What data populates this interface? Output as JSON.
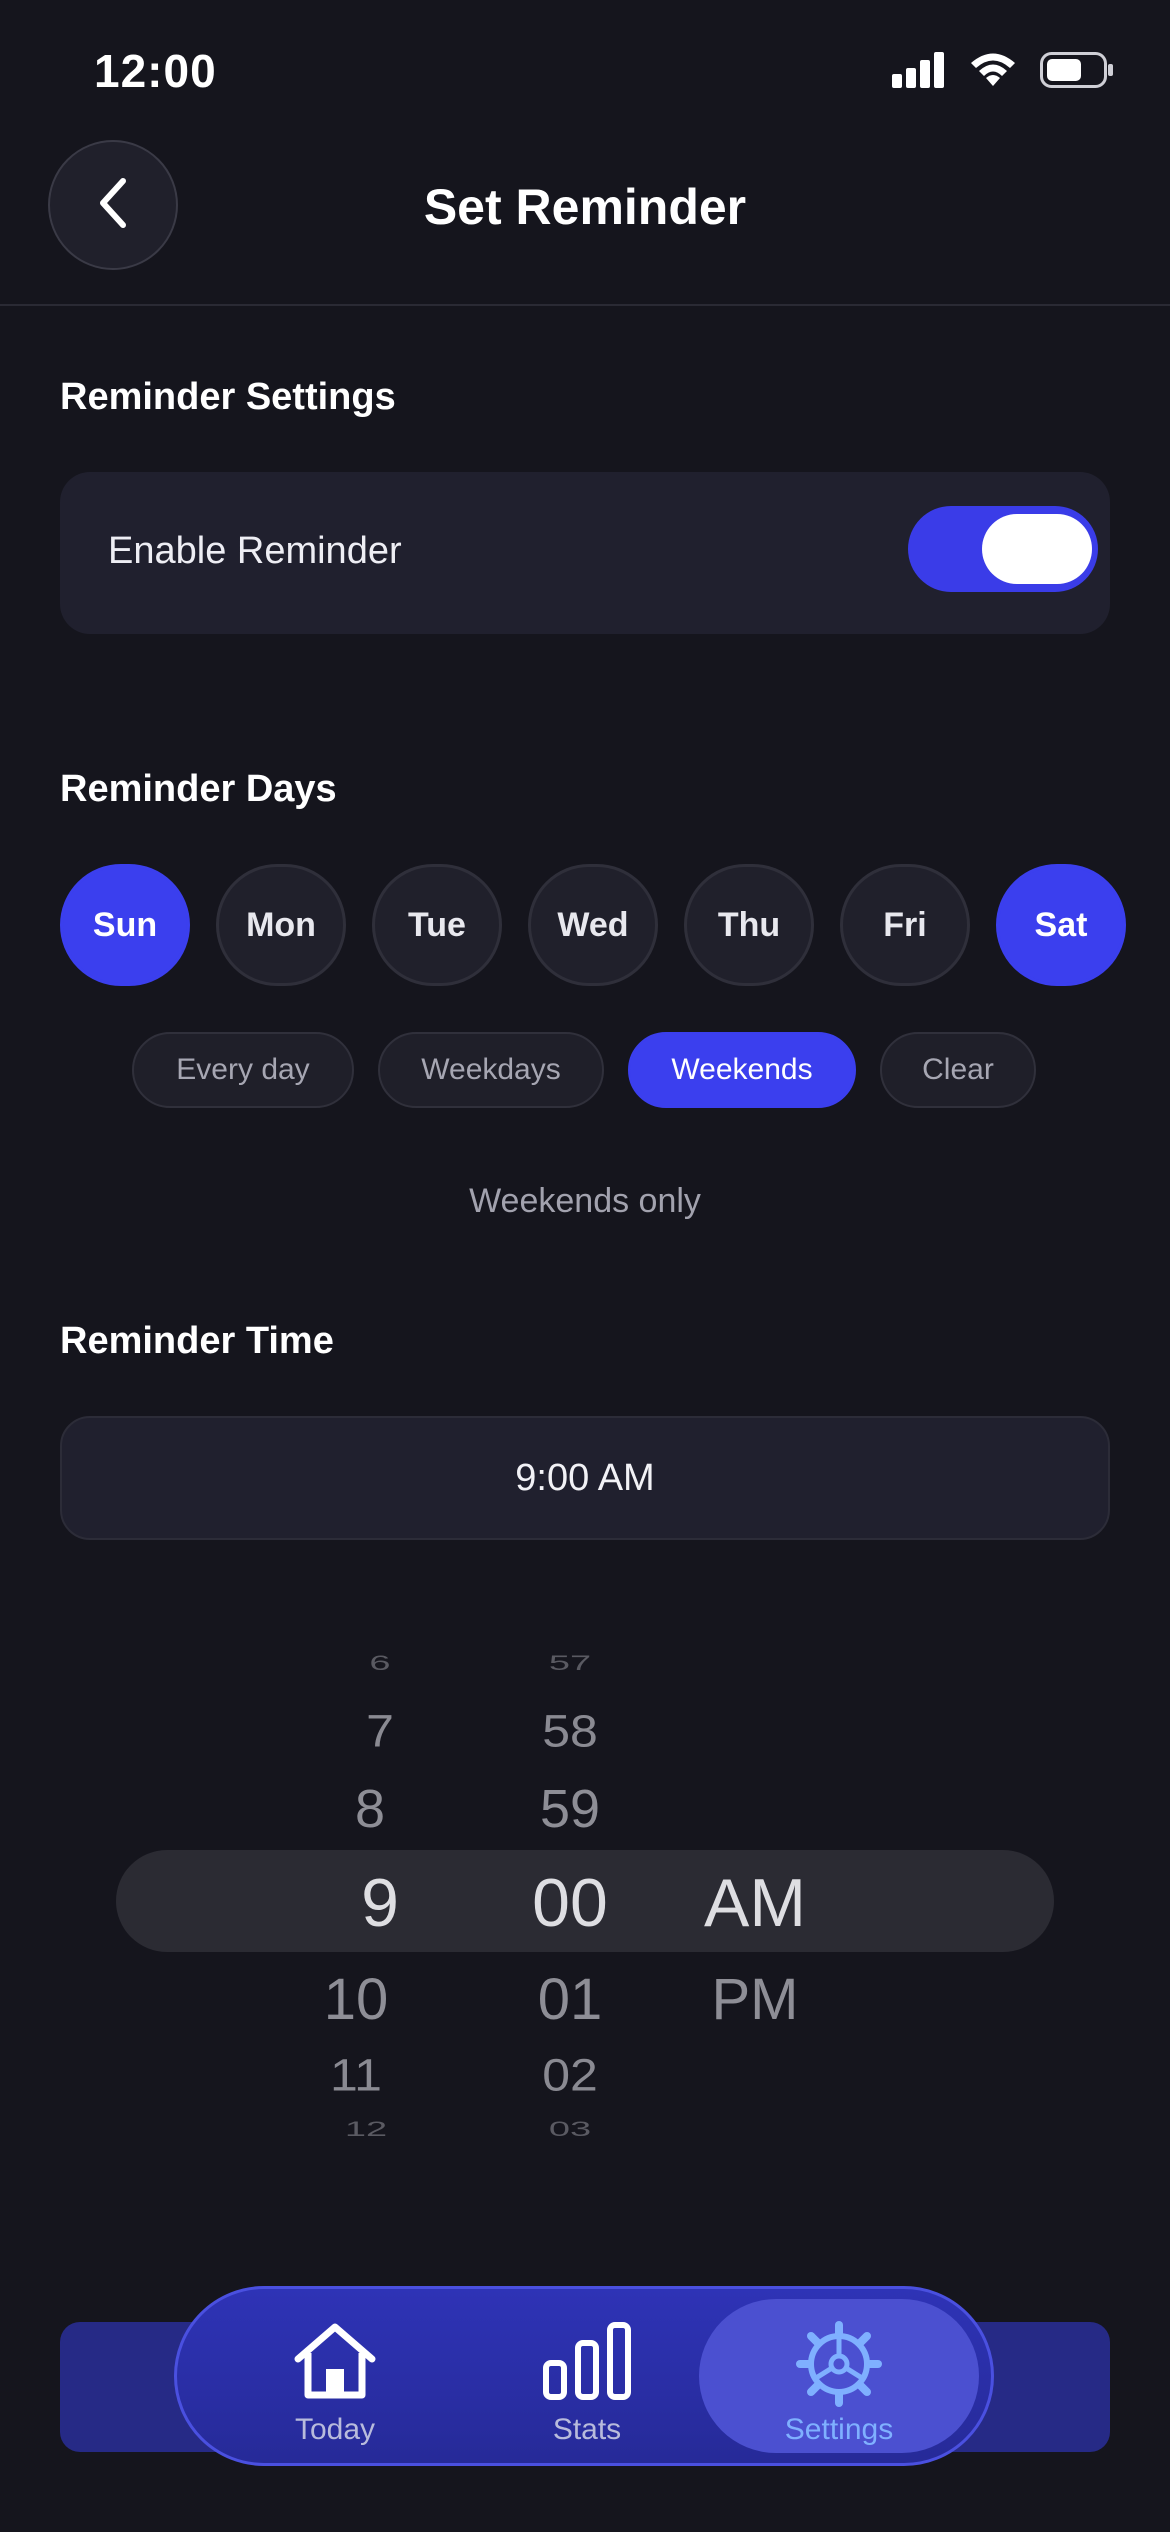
{
  "status_bar": {
    "time": "12:00"
  },
  "header": {
    "title": "Set Reminder"
  },
  "reminder_settings": {
    "section_title": "Reminder Settings",
    "enable_label": "Enable Reminder",
    "enabled": true
  },
  "reminder_days": {
    "section_title": "Reminder Days",
    "days": [
      {
        "label": "Sun",
        "selected": true
      },
      {
        "label": "Mon",
        "selected": false
      },
      {
        "label": "Tue",
        "selected": false
      },
      {
        "label": "Wed",
        "selected": false
      },
      {
        "label": "Thu",
        "selected": false
      },
      {
        "label": "Fri",
        "selected": false
      },
      {
        "label": "Sat",
        "selected": true
      }
    ],
    "presets": [
      {
        "label": "Every day",
        "selected": false
      },
      {
        "label": "Weekdays",
        "selected": false
      },
      {
        "label": "Weekends",
        "selected": true
      },
      {
        "label": "Clear",
        "selected": false
      }
    ],
    "summary": "Weekends only"
  },
  "reminder_time": {
    "section_title": "Reminder Time",
    "display": "9:00 AM",
    "picker": {
      "hours": [
        "6",
        "7",
        "8",
        "9",
        "10",
        "11",
        "12"
      ],
      "minutes": [
        "57",
        "58",
        "59",
        "00",
        "01",
        "02",
        "03"
      ],
      "periods": [
        "AM",
        "PM"
      ],
      "selected": {
        "hour": "9",
        "minute": "00",
        "period": "AM"
      }
    }
  },
  "tab_bar": {
    "tabs": [
      {
        "label": "Today",
        "icon": "home-icon",
        "active": false
      },
      {
        "label": "Stats",
        "icon": "bar-chart-icon",
        "active": false
      },
      {
        "label": "Settings",
        "icon": "gear-icon",
        "active": true
      }
    ]
  },
  "colors": {
    "accent": "#3b3fee",
    "background": "#15151d",
    "card": "#20202e",
    "active_tab_label": "#7fb0ff"
  }
}
